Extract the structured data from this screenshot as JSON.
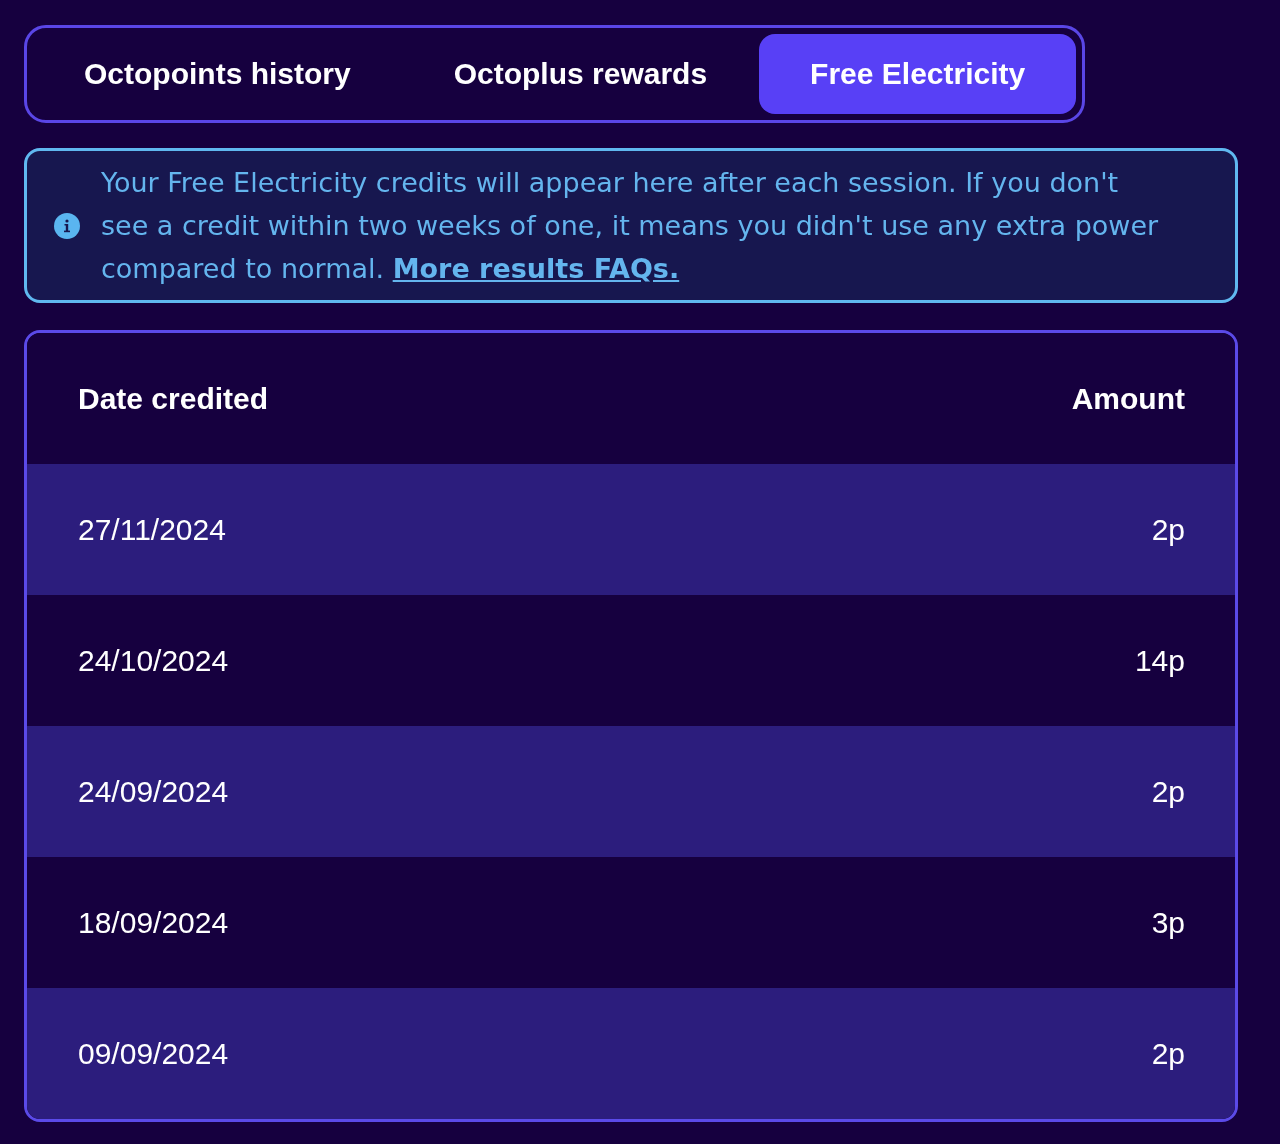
{
  "tabs": [
    {
      "label": "Octopoints history",
      "selected": false
    },
    {
      "label": "Octoplus rewards",
      "selected": false
    },
    {
      "label": "Free Electricity",
      "selected": true
    }
  ],
  "notice": {
    "text": "Your Free Electricity credits will appear here after each session. If you don't see a credit within two weeks of one, it means you didn't use any extra power compared to normal.",
    "link": "More results FAQs."
  },
  "table": {
    "columns": [
      "Date credited",
      "Amount"
    ],
    "rows": [
      [
        "27/11/2024",
        "2p"
      ],
      [
        "24/10/2024",
        "14p"
      ],
      [
        "24/09/2024",
        "2p"
      ],
      [
        "18/09/2024",
        "3p"
      ],
      [
        "09/09/2024",
        "2p"
      ]
    ]
  }
}
